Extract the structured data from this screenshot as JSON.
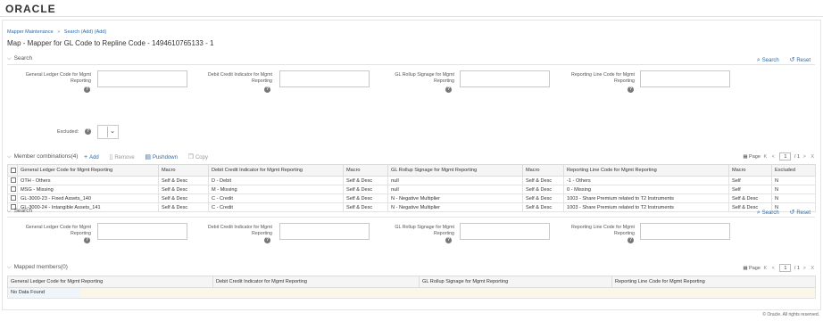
{
  "app": {
    "logo": "ORACLE"
  },
  "breadcrumb": {
    "item1": "Mapper Maintenance",
    "sep": "»",
    "item2": "Search",
    "item3": "(Add)",
    "item4": "(Add)"
  },
  "page": {
    "title": "Map - Mapper for GL Code to Repline Code - 1494610765133 - 1"
  },
  "search_section": {
    "title": "Search",
    "search_label": "Search",
    "reset_label": "Reset",
    "fields": {
      "gl_code": "General Ledger Code for Mgmt Reporting",
      "debit_credit": "Debit Credit Indicator for Mgmt Reporting",
      "gl_rollup": "GL Rollup Signage for Mgmt Reporting",
      "reporting_line": "Reporting Line Code for Mgmt Reporting"
    },
    "excluded_label": "Excluded:",
    "help_glyph": "?"
  },
  "member_section": {
    "title": "Member combinations(4)",
    "toolbar": {
      "add": "Add",
      "remove": "Remove",
      "pushdown": "Pushdown",
      "copy": "Copy"
    },
    "pager": {
      "label": "Page",
      "first": "K",
      "prev": "<",
      "current": "1",
      "total": "/ 1",
      "next": ">",
      "last": "X"
    },
    "columns": [
      "General Ledger Code for Mgmt Reporting",
      "Macro",
      "Debit Credit Indicator for Mgmt Reporting",
      "Macro",
      "GL Rollup Signage for Mgmt Reporting",
      "Macro",
      "Reporting Line Code for Mgmt Reporting",
      "Macro",
      "Excluded"
    ],
    "rows": [
      [
        "OTH - Others",
        "Self & Desc",
        "D - Debit",
        "Self & Desc",
        "null",
        "Self & Desc",
        "-1 - Others",
        "Self",
        "N"
      ],
      [
        "MSG - Missing",
        "Self & Desc",
        "M - Missing",
        "Self & Desc",
        "null",
        "Self & Desc",
        "0 - Missing",
        "Self",
        "N"
      ],
      [
        "GL-3000-23 - Fixed Assets_140",
        "Self & Desc",
        "C - Credit",
        "Self & Desc",
        "N - Negative Multiplier",
        "Self & Desc",
        "1003 - Share Premium related to T2 Instruments",
        "Self & Desc",
        "N"
      ],
      [
        "GL-3000-24 - Intangible Assets_141",
        "Self & Desc",
        "C - Credit",
        "Self & Desc",
        "N - Negative Multiplier",
        "Self & Desc",
        "1003 - Share Premium related to T2 Instruments",
        "Self & Desc",
        "N"
      ]
    ]
  },
  "search2_section": {
    "title": "Search",
    "search_label": "Search",
    "reset_label": "Reset"
  },
  "mapped_section": {
    "title": "Mapped members(0)",
    "pager": {
      "label": "Page",
      "first": "K",
      "prev": "<",
      "current": "1",
      "total": "/ 1",
      "next": ">",
      "last": "X"
    },
    "columns": [
      "General Ledger Code for Mgmt Reporting",
      "Debit Credit Indicator for Mgmt Reporting",
      "GL Rollup Signage for Mgmt Reporting",
      "Reporting Line Code for Mgmt Reporting"
    ],
    "no_data": "No Data Found"
  },
  "footer": {
    "copyright": "© Oracle. All rights reserved."
  },
  "icons": {
    "search": "magnifier-icon",
    "reset": "reset-arrow-icon",
    "add": "plus-icon",
    "remove": "trash-icon",
    "pushdown": "pushdown-icon",
    "copy": "copy-icon",
    "select_caret": "chevron-down-icon"
  },
  "colors": {
    "link": "#2a6aaa",
    "header_bg": "#f5f5f5",
    "nodata_row": "#fbf7e8",
    "nodata_cell": "#eef5fb"
  }
}
